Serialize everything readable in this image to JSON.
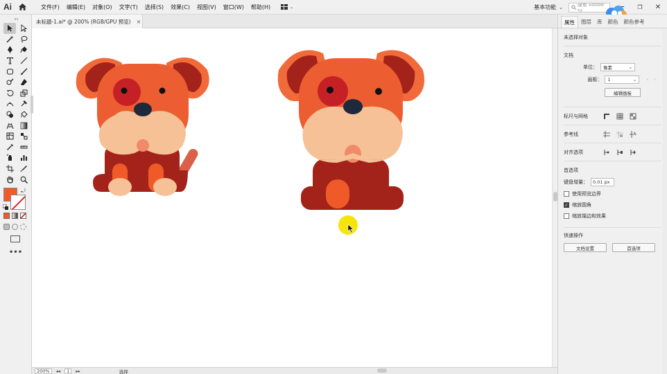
{
  "app": {
    "logo": "Ai"
  },
  "menu": [
    "文件(F)",
    "编辑(E)",
    "对象(O)",
    "文字(T)",
    "选择(S)",
    "效果(C)",
    "视图(V)",
    "窗口(W)",
    "帮助(H)"
  ],
  "workspace_label": "基本功能",
  "search_placeholder": "搜索 Adobe St",
  "document_tab": {
    "title": "未标题-1.ai* @ 200% (RGB/GPU 预览)",
    "close": "×"
  },
  "status_bar": {
    "zoom": "200%",
    "artboard": "1",
    "tool": "选择"
  },
  "panel": {
    "tabs": [
      "属性",
      "图层",
      "库",
      "颜色",
      "颜色参考"
    ],
    "no_selection": "未选择对象",
    "document_section": "文档",
    "units_label": "单位：",
    "units_value": "像素",
    "artboard_label": "画板：",
    "artboard_value": "1",
    "edit_artboard_button": "编辑画板",
    "rulers_grids_label": "标尺与网格",
    "guides_label": "参考线",
    "snap_label": "对齐选项",
    "preferences_section": "首选项",
    "keyboard_increment_label": "键盘增量：",
    "keyboard_increment_value": "0.01 px",
    "use_preview_bounds": "使用预览边界",
    "scale_corners": "缩放圆角",
    "scale_strokes_effects": "缩放描边和效果",
    "quick_actions_section": "快速操作",
    "document_setup_button": "文档设置",
    "preferences_button": "首选项"
  },
  "colors": {
    "fill": "#f05a28",
    "dog_ear": "#a3221a",
    "dog_ear_outline": "#f06a3a",
    "dog_head": "#ed5d32",
    "dog_muzzle": "#f6c196",
    "dog_nose": "#1e2a3c",
    "dog_eye_patch": "#c62027",
    "dog_body": "#a3221a",
    "dog_belly": "#f05a28",
    "dog_tail": "#d9614a",
    "cursor_highlight": "#f5e50a"
  }
}
